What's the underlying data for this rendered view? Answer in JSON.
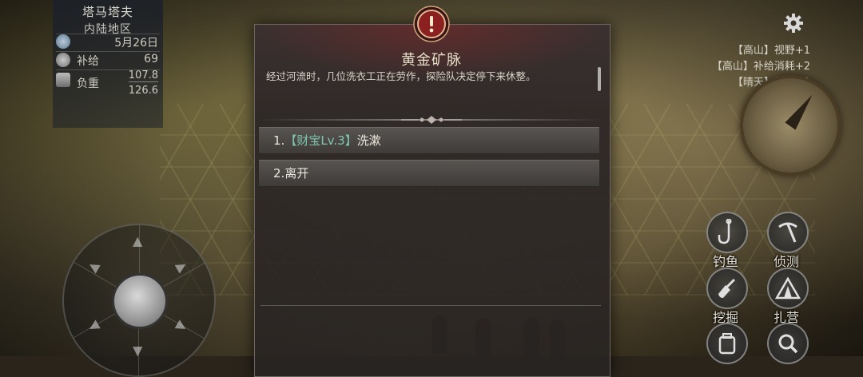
{
  "location": {
    "name": "塔马塔夫",
    "region": "内陆地区"
  },
  "stats": {
    "date": "5月26日",
    "supply_label": "补给",
    "supply_value": "69",
    "weight_label": "负重",
    "weight_current": "107.8",
    "weight_max": "126.6"
  },
  "buffs": [
    "【高山】视野+1",
    "【高山】补给消耗+2",
    "【晴天】视野+1"
  ],
  "event": {
    "title": "黄金矿脉",
    "description": "经过河流时，几位洗衣工正在劳作，探险队决定停下来休整。",
    "options": [
      {
        "prefix": "1.",
        "tag": "【财宝Lv.3】",
        "text": "洗漱"
      },
      {
        "prefix": "2.",
        "tag": "",
        "text": "离开"
      }
    ]
  },
  "actions": {
    "fish": "钓鱼",
    "scout": "侦测",
    "dig": "挖掘",
    "camp": "扎营"
  },
  "icons": {
    "settings": "gear-icon",
    "alert": "exclamation-icon",
    "fish": "fishhook-icon",
    "scout": "pickaxe-icon",
    "dig": "shovel-icon",
    "camp": "tent-icon",
    "inventory": "backpack-icon",
    "search": "magnifier-icon"
  },
  "colors": {
    "option_tag": "#7fc6b0",
    "alert_red": "#8a2020"
  }
}
